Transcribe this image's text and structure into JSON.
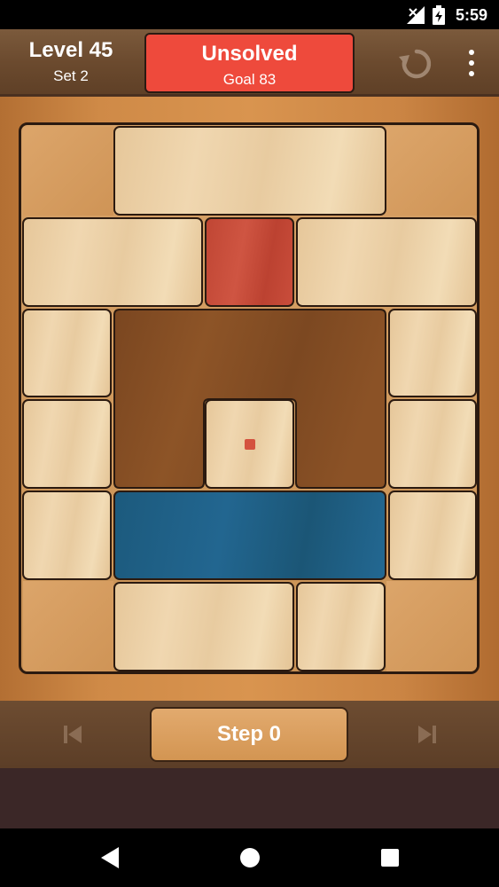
{
  "status_bar": {
    "time": "5:59"
  },
  "header": {
    "level_title": "Level 45",
    "set_label": "Set 2",
    "status_title": "Unsolved",
    "goal_label": "Goal 83",
    "status_color": "#ee4a3c"
  },
  "board": {
    "tiles": [
      {
        "name": "tile-top-wide",
        "color": "light"
      },
      {
        "name": "tile-row2-left-wide",
        "color": "light"
      },
      {
        "name": "tile-red-square",
        "color": "red"
      },
      {
        "name": "tile-row2-right-wide",
        "color": "light"
      },
      {
        "name": "tile-left-1",
        "color": "light"
      },
      {
        "name": "tile-brown-u-shape",
        "color": "brown"
      },
      {
        "name": "tile-right-1",
        "color": "light"
      },
      {
        "name": "tile-left-2",
        "color": "light"
      },
      {
        "name": "tile-center-small",
        "color": "light"
      },
      {
        "name": "tile-right-2",
        "color": "light"
      },
      {
        "name": "tile-left-3",
        "color": "light"
      },
      {
        "name": "tile-blue-bar",
        "color": "blue"
      },
      {
        "name": "tile-right-3",
        "color": "light"
      },
      {
        "name": "tile-bottom-wide",
        "color": "light"
      },
      {
        "name": "tile-bottom-small",
        "color": "light"
      }
    ]
  },
  "footer": {
    "step_label": "Step 0",
    "prev_icon": "skip-previous-icon",
    "next_icon": "skip-next-icon"
  },
  "navbar": {
    "back_icon": "back-triangle-icon",
    "home_icon": "home-circle-icon",
    "recent_icon": "recents-square-icon"
  }
}
